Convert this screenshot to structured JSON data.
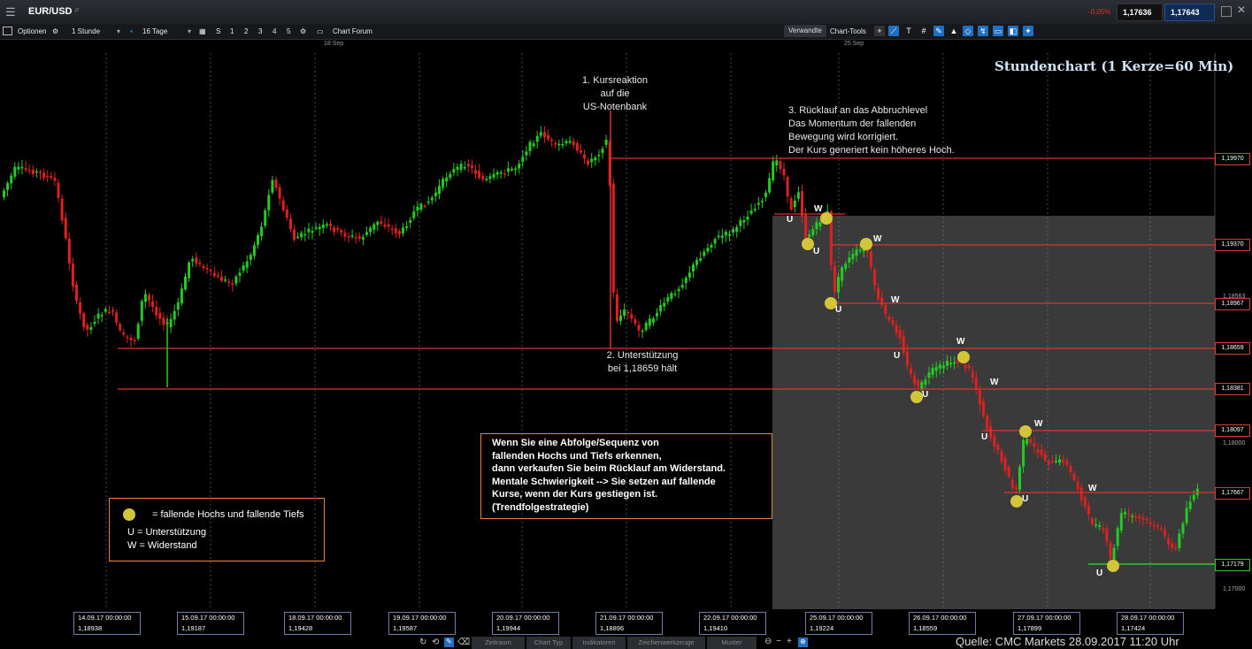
{
  "titlebar": {
    "symbol": "EUR/USD",
    "change": "-0,05%",
    "sell": "1,17636",
    "buy": "1,17643"
  },
  "toolbar": {
    "options": "Optionen",
    "interval": "1 Stunde",
    "range": "16 Tage",
    "nums": [
      "S",
      "1",
      "2",
      "3",
      "4",
      "5"
    ],
    "forum": "Chart Forum",
    "related": "Verwandte",
    "tools": "Chart-Tools"
  },
  "dates": {
    "d1": "18 Sep",
    "d2": "25 Sep"
  },
  "chart": {
    "title": "Stundenchart (1 Kerze=60 Min)",
    "ann1": [
      "1. Kursreaktion",
      "auf die",
      "US-Notenbank"
    ],
    "ann2": [
      "2. Unterstützung",
      "bei 1,18659 hält"
    ],
    "ann3": [
      "3. Rücklauf an das Abbruchlevel",
      "Das Momentum der fallenden",
      "Bewegung wird korrigiert.",
      "Der Kurs generiert kein höheres Hoch."
    ],
    "info": [
      "Wenn Sie eine Abfolge/Sequenz von",
      "fallenden Hochs und Tiefs erkennen,",
      "dann verkaufen Sie beim Rücklauf am Widerstand.",
      "Mentale Schwierigkeit --> Sie setzen auf fallende",
      "Kurse, wenn der Kurs gestiegen ist.",
      "(Trendfolgestrategie)"
    ],
    "legend": [
      "= fallende Hochs und fallende Tiefs",
      "U  = Unterstützung",
      "W = Widerstand"
    ]
  },
  "levels": [
    "1,19970",
    "1,19370",
    "1,18967",
    "1,18659",
    "1,18381",
    "1,18097",
    "1,17667",
    "1,17179"
  ],
  "ylabels": [
    "1,18563",
    "1,18000",
    "1,17000"
  ],
  "xlabels": [
    {
      "d": "14.09.17 00:00:00",
      "v": "1,18938"
    },
    {
      "d": "15.09.17 00:00:00",
      "v": "1,19187"
    },
    {
      "d": "18.09.17 00:00:00",
      "v": "1,19428"
    },
    {
      "d": "19.09.17 00:00:00",
      "v": "1,19587"
    },
    {
      "d": "20.09.17 00:00:00",
      "v": "1,19944"
    },
    {
      "d": "21.09.17 00:00:00",
      "v": "1,18896"
    },
    {
      "d": "22.09.17 00:00:00",
      "v": "1,19410"
    },
    {
      "d": "25.09.17 00:00:00",
      "v": "1,19224"
    },
    {
      "d": "26.09.17 00:00:00",
      "v": "1,18559"
    },
    {
      "d": "27.09.17 00:00:00",
      "v": "1,17899"
    },
    {
      "d": "28.09.17 00:00:00",
      "v": "1,17424"
    }
  ],
  "bottom": {
    "tabs": [
      "Zeitraum",
      "Chart Typ",
      "Indikatoren",
      "Zeichenwerkzeuge",
      "Muster"
    ],
    "source": "Quelle: CMC Markets 28.09.2017 11:20 Uhr"
  },
  "markers": {
    "u": "U",
    "w": "W"
  },
  "colors": {
    "up": "#22cc22",
    "down": "#e02020",
    "level": "#e03030",
    "dot": "#d4c43a",
    "box": "#e8823a"
  }
}
